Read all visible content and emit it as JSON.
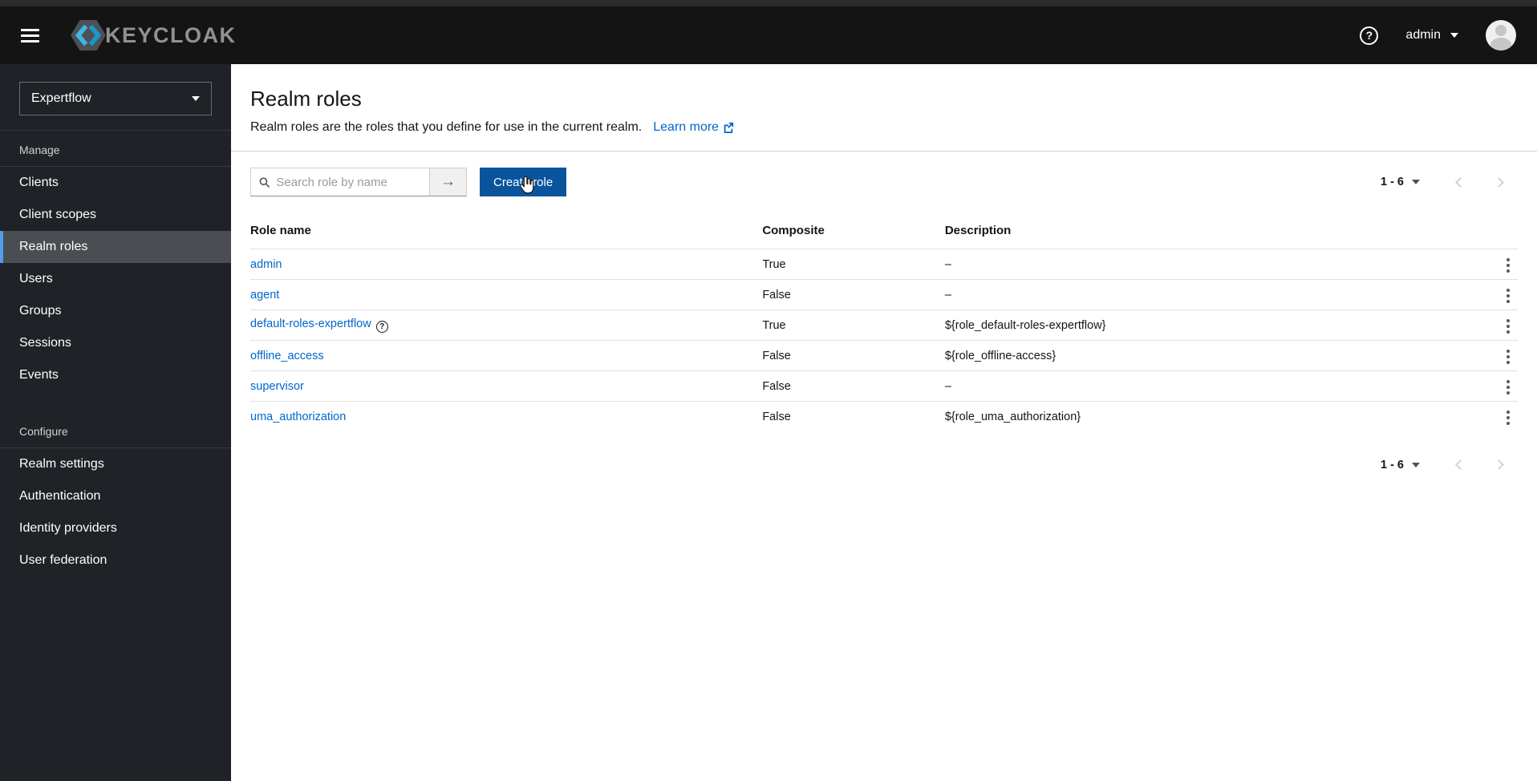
{
  "topbar": {
    "brand": "KEYCLOAK",
    "username": "admin"
  },
  "sidebar": {
    "realm": "Expertflow",
    "sections": [
      {
        "label": "Manage",
        "items": [
          "Clients",
          "Client scopes",
          "Realm roles",
          "Users",
          "Groups",
          "Sessions",
          "Events"
        ]
      },
      {
        "label": "Configure",
        "items": [
          "Realm settings",
          "Authentication",
          "Identity providers",
          "User federation"
        ]
      }
    ],
    "active_item": "Realm roles"
  },
  "page": {
    "title": "Realm roles",
    "description": "Realm roles are the roles that you define for use in the current realm.",
    "learn_more_label": "Learn more"
  },
  "toolbar": {
    "search_placeholder": "Search role by name",
    "create_button_label": "Create role"
  },
  "pagination": {
    "range": "1 - 6"
  },
  "table": {
    "columns": [
      "Role name",
      "Composite",
      "Description"
    ],
    "rows": [
      {
        "name": "admin",
        "composite": "True",
        "description": "–"
      },
      {
        "name": "agent",
        "composite": "False",
        "description": "–"
      },
      {
        "name": "default-roles-expertflow",
        "composite": "True",
        "description": "${role_default-roles-expertflow}"
      },
      {
        "name": "offline_access",
        "composite": "False",
        "description": "${role_offline-access}"
      },
      {
        "name": "supervisor",
        "composite": "False",
        "description": "–"
      },
      {
        "name": "uma_authorization",
        "composite": "False",
        "description": "${role_uma_authorization}"
      }
    ]
  },
  "colors": {
    "primary_button": "#0a549e",
    "link": "#0066cc",
    "active_nav_indicator": "#519de9",
    "topbar_bg": "#141414",
    "sidebar_bg": "#1f2226"
  }
}
